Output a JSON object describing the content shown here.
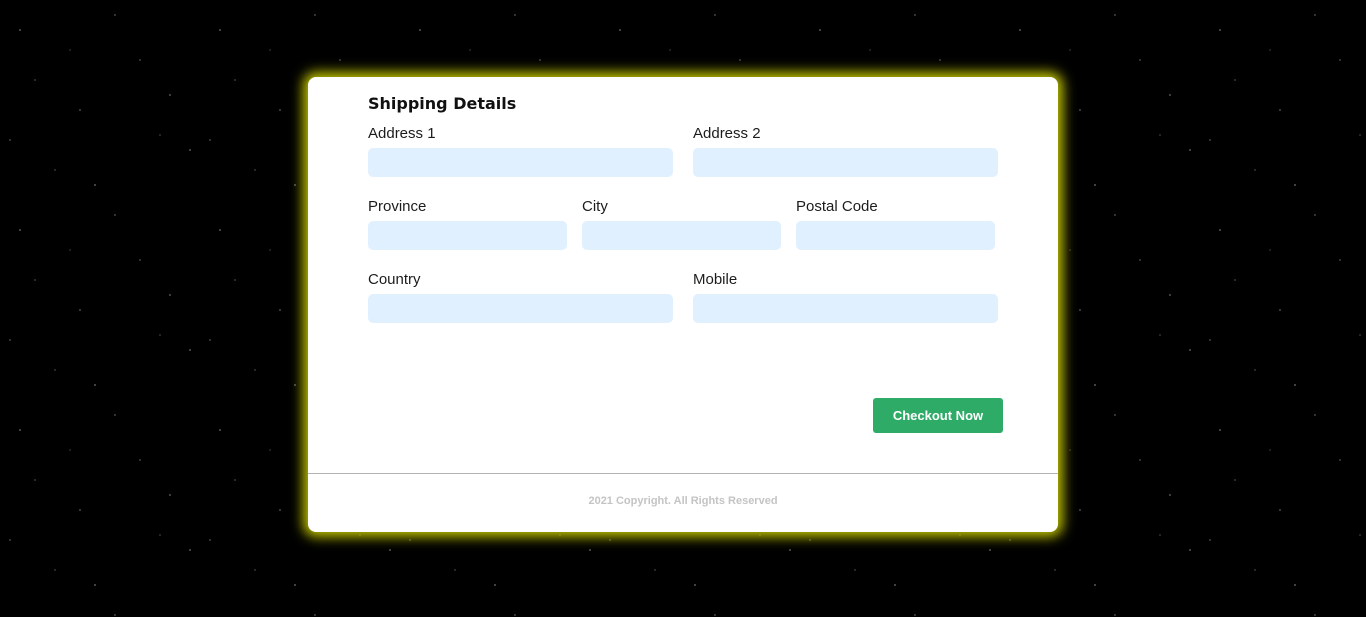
{
  "form": {
    "title": "Shipping Details",
    "fields": {
      "address1": {
        "label": "Address 1",
        "value": "",
        "placeholder": ""
      },
      "address2": {
        "label": "Address 2",
        "value": "",
        "placeholder": ""
      },
      "province": {
        "label": "Province",
        "value": "",
        "placeholder": ""
      },
      "city": {
        "label": "City",
        "value": "",
        "placeholder": ""
      },
      "postal_code": {
        "label": "Postal Code",
        "value": "",
        "placeholder": ""
      },
      "country": {
        "label": "Country",
        "value": "",
        "placeholder": ""
      },
      "mobile": {
        "label": "Mobile",
        "value": "",
        "placeholder": ""
      }
    },
    "checkout_label": "Checkout Now"
  },
  "footer": {
    "copyright": "2021 Copyright. All Rights Reserved"
  },
  "colors": {
    "card_glow": "#dee200",
    "input_background": "#e1f0fe",
    "button_background": "#2fab68",
    "page_background": "#000000"
  }
}
